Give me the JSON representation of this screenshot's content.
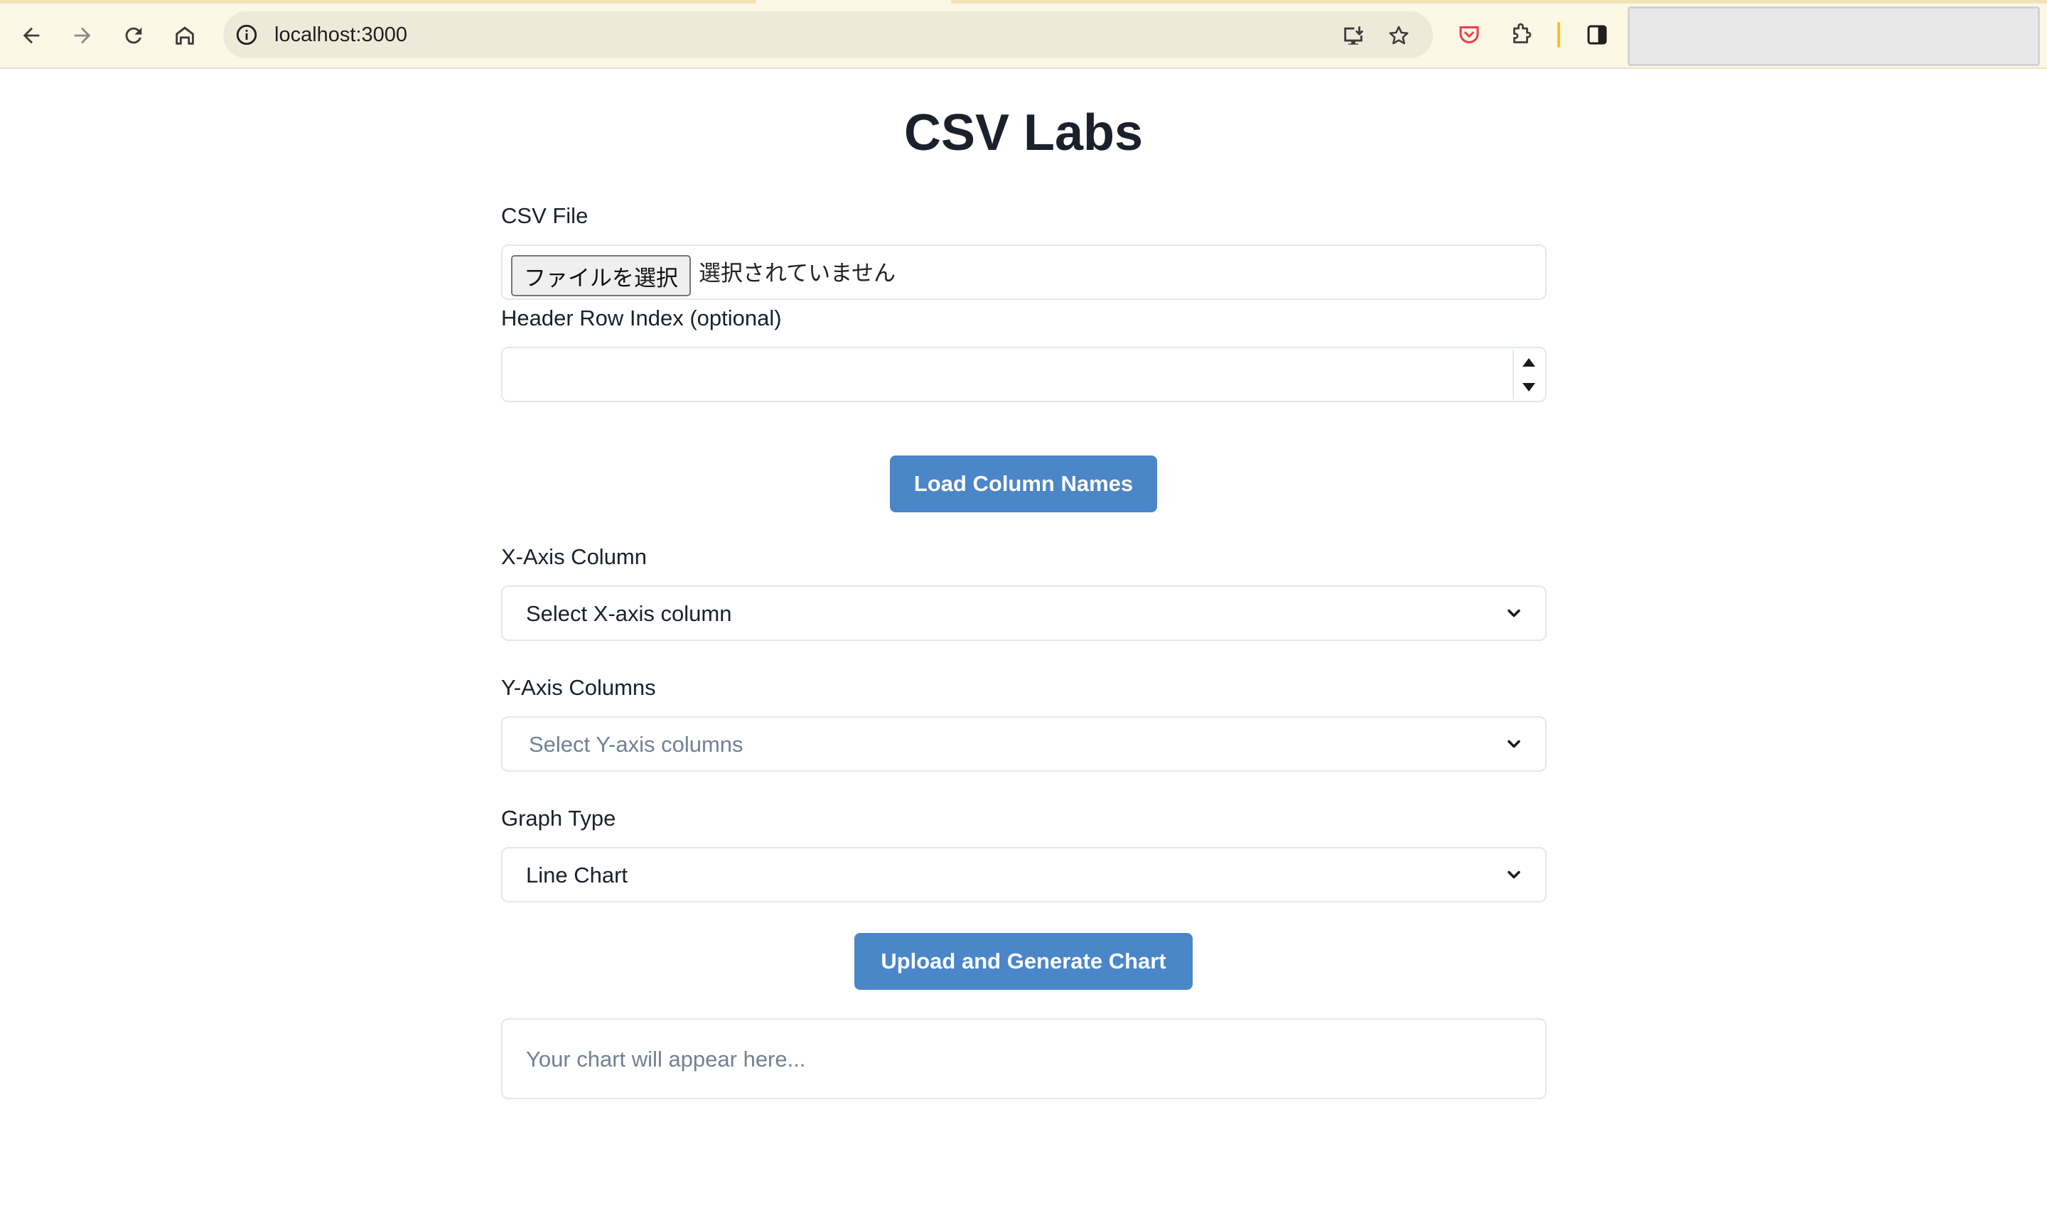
{
  "browser": {
    "url": "localhost:3000",
    "icons": {
      "back": "arrow-left-icon",
      "forward": "arrow-right-icon",
      "reload": "reload-icon",
      "home": "home-icon",
      "site_info": "info-icon",
      "install": "install-app-icon",
      "bookmark": "star-icon",
      "pocket": "pocket-icon",
      "extensions": "puzzle-icon",
      "side_panel": "side-panel-icon"
    }
  },
  "app": {
    "title": "CSV Labs",
    "csv_file": {
      "label": "CSV File",
      "button_label": "ファイルを選択",
      "status": "選択されていません"
    },
    "header_row": {
      "label": "Header Row Index (optional)",
      "value": ""
    },
    "load_button": "Load Column Names",
    "x_axis": {
      "label": "X-Axis Column",
      "selected": "Select X-axis column"
    },
    "y_axis": {
      "label": "Y-Axis Columns",
      "placeholder": "Select Y-axis columns"
    },
    "graph_type": {
      "label": "Graph Type",
      "selected": "Line Chart"
    },
    "generate_button": "Upload and Generate Chart",
    "chart_placeholder": "Your chart will appear here..."
  },
  "colors": {
    "primary_button": "#4a86c8",
    "chrome_bg": "#fdf7e6",
    "pocket": "#e8404a",
    "divider": "#f5c518"
  }
}
